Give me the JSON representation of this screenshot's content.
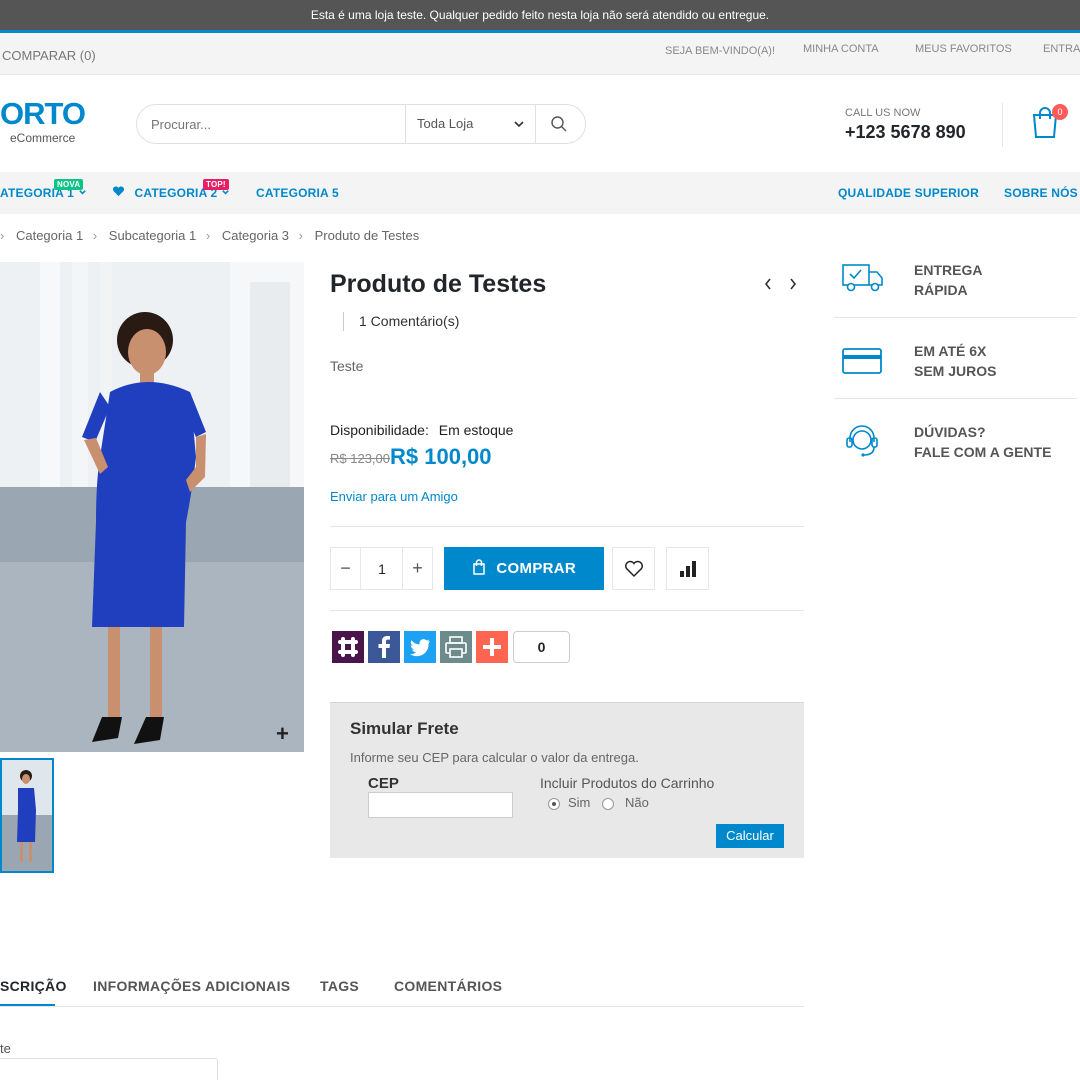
{
  "notice": "Esta é uma loja teste. Qualquer pedido feito nesta loja não será atendido ou entregue.",
  "topbar": {
    "compare": "COMPARAR (0)",
    "welcome": "SEJA BEM-VINDO(A)!",
    "account": "MINHA CONTA",
    "favorites": "MEUS FAVORITOS",
    "login": "ENTRA"
  },
  "header": {
    "logo_big": "ORTO",
    "logo_small": "eCommerce",
    "search_placeholder": "Procurar...",
    "search_scope": "Toda Loja",
    "call_label": "CALL US NOW",
    "phone": "+123 5678 890",
    "cart_count": "0"
  },
  "nav": {
    "items": [
      "ATEGORIA 1",
      "CATEGORIA 2",
      "CATEGORIA 5"
    ],
    "tag_new": "NOVA",
    "tag_top": "TOP!",
    "right": [
      "QUALIDADE SUPERIOR",
      "SOBRE NÓS"
    ]
  },
  "breadcrumb": [
    "Categoria 1",
    "Subcategoria 1",
    "Categoria 3",
    "Produto de Testes"
  ],
  "product": {
    "title": "Produto de Testes",
    "reviews": "1 Comentário(s)",
    "short_desc": "Teste",
    "availability_label": "Disponibilidade:",
    "availability_value": "Em estoque",
    "old_price": "R$ 123,00",
    "price": "R$ 100,00",
    "send_friend": "Enviar para um Amigo",
    "qty": "1",
    "buy_label": "COMPRAR",
    "share_count": "0"
  },
  "frete": {
    "title": "Simular Frete",
    "desc": "Informe seu CEP para calcular o valor da entrega.",
    "cep_label": "CEP",
    "include_label": "Incluir Produtos do Carrinho",
    "yes": "Sim",
    "no": "Não",
    "calc": "Calcular"
  },
  "features": [
    {
      "line1": "ENTREGA",
      "line2": "RÁPIDA",
      "icon": "truck-icon"
    },
    {
      "line1": "EM ATÉ 6X",
      "line2": "SEM JUROS",
      "icon": "credit-card-icon"
    },
    {
      "line1": "DÚVIDAS?",
      "line2": "FALE COM A GENTE",
      "icon": "headset-icon"
    }
  ],
  "tabs": [
    "SCRIÇÃO",
    "INFORMAÇÕES ADICIONAIS",
    "TAGS",
    "COMENTÁRIOS"
  ],
  "tab_content": "te",
  "colors": {
    "accent": "#0088cc",
    "tag_new": "#0cc485",
    "tag_top": "#e91e63",
    "badge": "#ff5b5b"
  }
}
